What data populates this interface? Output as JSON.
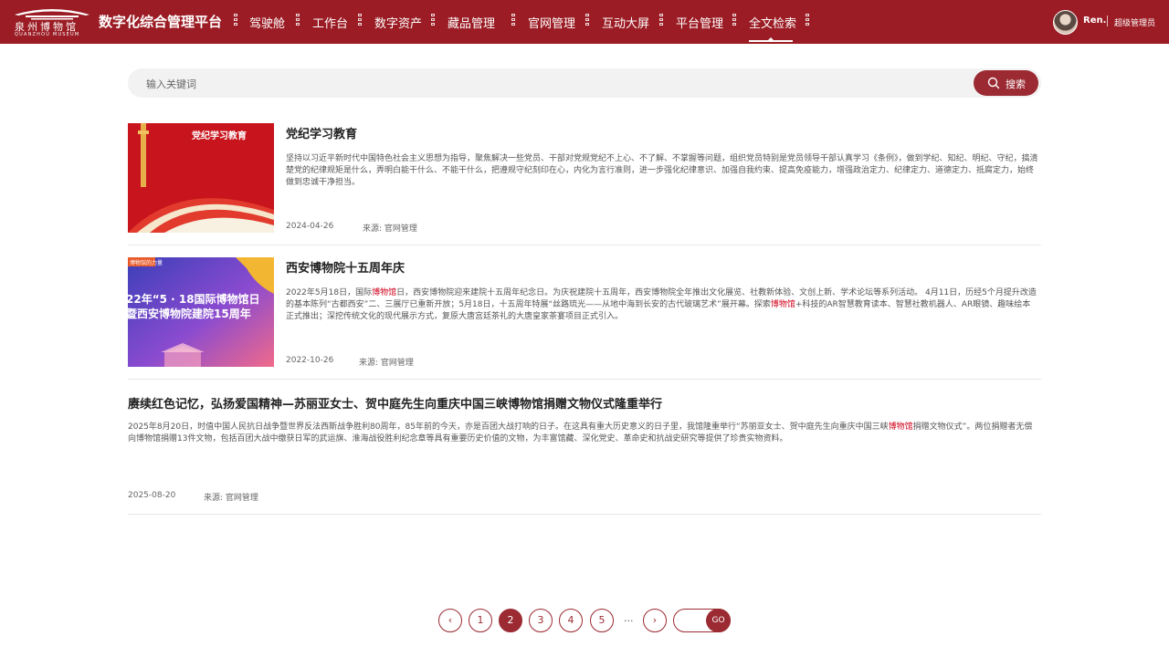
{
  "header": {
    "logo": {
      "name_cn": "泉州博物馆",
      "name_en": "QUANZHOU MUSEUM"
    },
    "system_title": "数字化综合管理平台",
    "nav": [
      {
        "label": "驾驶舱",
        "active": false
      },
      {
        "label": "工作台",
        "active": false
      },
      {
        "label": "数字资产",
        "active": false
      },
      {
        "label": "藏品管理",
        "active": false
      },
      {
        "label": "官网管理",
        "active": false
      },
      {
        "label": "互动大屏",
        "active": false
      },
      {
        "label": "平台管理",
        "active": false
      },
      {
        "label": "全文检索",
        "active": true
      }
    ],
    "user": {
      "name": "Ren.",
      "role": "超级管理员"
    }
  },
  "search": {
    "placeholder": "输入关键词",
    "button_label": "搜索"
  },
  "results": [
    {
      "title": "党纪学习教育",
      "thumb_text": "党纪学习教育",
      "desc_parts": [
        "坚持以习近平新时代中国特色社会主义思想为指导，聚焦解决一些党员、干部对党规党纪不上心、不了解、不掌握等问题，组织党员特别是党员领导干部认真学习《条例》，做到学纪、知纪、明纪、守纪，搞清楚党的纪律规矩是什么，弄明白能干什么、不能干什么，把遵规守纪刻印在心，内化为言行准则，进一步强化纪律意识、加强自我约束、提高免疫能力，增强政治定力、纪律定力、道德定力、抵腐定力，始终做到忠诚干净担当。"
      ],
      "date": "2024-04-26",
      "source": "来源: 官网管理"
    },
    {
      "title": "西安博物院十五周年庆",
      "thumb_text_1": "22年“5 · 18国际博物馆日",
      "thumb_text_2": "暨西安博物院建院15周年",
      "thumb_tag": "博物馆的力量",
      "desc_parts": [
        "2022年5月18日，国际",
        "博物馆",
        "日，西安博物院迎来建院十五周年纪念日。为庆祝建院十五周年，西安博物院全年推出文化展览、社教新体验、文创上新、学术论坛等系列活动。 4月11日，历经5个月提升改造的基本陈列“古都西安”二、三展厅已重新开放；5月18日，十五周年特展“丝路琉光——从地中海到长安的古代玻璃艺术”展开幕。探索",
        "博物馆",
        "+科技的AR智慧教育读本、智慧社教机器人、AR眼镜、趣味绘本正式推出；深挖传统文化的现代展示方式，复原大唐宫廷茶礼的大唐皇家茶宴项目正式引入。"
      ],
      "date": "2022-10-26",
      "source": "来源: 官网管理"
    },
    {
      "title": "赓续红色记忆，弘扬爱国精神—苏丽亚女士、贺中庭先生向重庆中国三峡博物馆捐赠文物仪式隆重举行",
      "desc_parts": [
        "2025年8月20日，时值中国人民抗日战争暨世界反法西斯战争胜利80周年，85年前的今天，亦是百团大战打响的日子。在这具有重大历史意义的日子里，我馆隆重举行“苏丽亚女士、贺中庭先生向重庆中国三峡",
        "博物馆",
        "捐赠文物仪式”。两位捐赠者无偿向博物馆捐赠13件文物，包括百团大战中缴获日军的武运旗、淮海战役胜利纪念章等具有重要历史价值的文物，为丰富馆藏、深化党史、革命史和抗战史研究等提供了珍贵实物资料。"
      ],
      "date": "2025-08-20",
      "source": "来源: 官网管理"
    }
  ],
  "pagination": {
    "prev": "‹",
    "pages": [
      "1",
      "2",
      "3",
      "4",
      "5"
    ],
    "current": "2",
    "ellipsis": "...",
    "next": "›",
    "go_label": "GO"
  },
  "colors": {
    "brand_red": "#9b1c24",
    "button_red": "#9b2a32",
    "highlight": "#d0021b"
  }
}
